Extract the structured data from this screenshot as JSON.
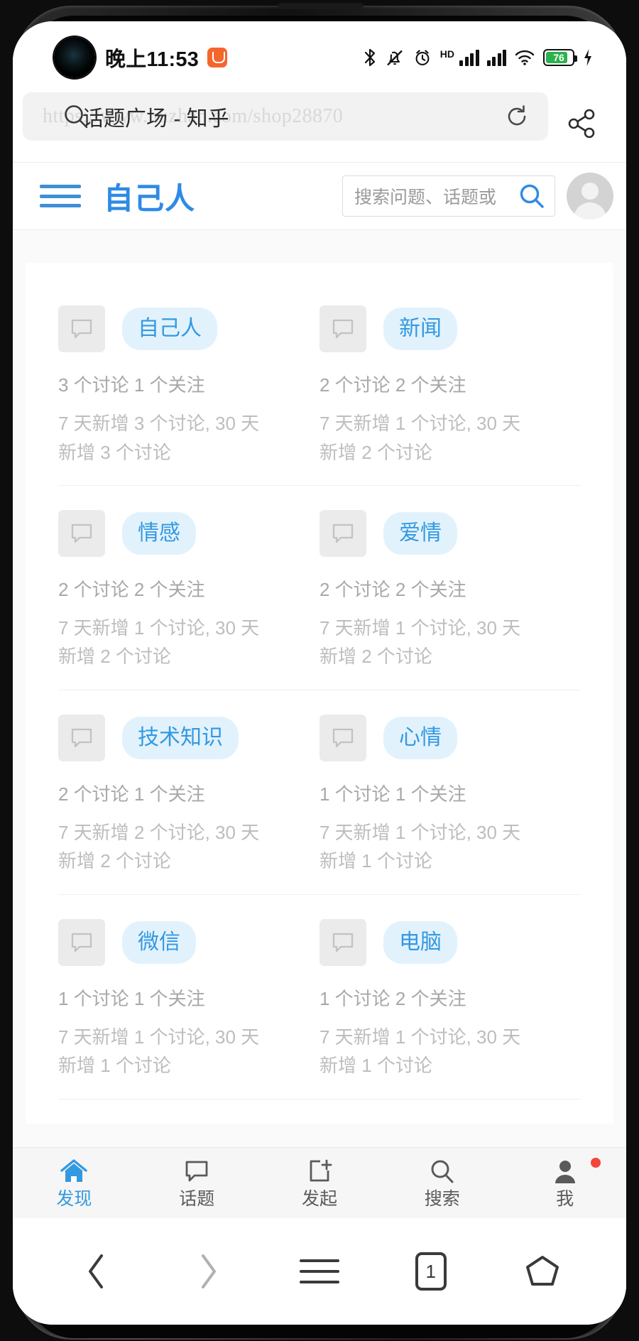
{
  "status_bar": {
    "time": "晚上11:53",
    "app_badge_icon": "orange-app-badge-icon",
    "icons": [
      "bluetooth-icon",
      "mute-bell-icon",
      "alarm-icon",
      "hd-icon",
      "signal-sim1-icon",
      "signal-sim2-icon",
      "wifi-icon",
      "battery-icon",
      "charging-icon"
    ],
    "hd_label": "HD",
    "battery_percent": "76"
  },
  "browser": {
    "url_watermark": "https://www.huzhan.com/shop28870",
    "page_title": "话题广场 - 知乎",
    "search_icon": "search-icon",
    "reload_icon": "reload-icon",
    "share_icon": "share-icon"
  },
  "site_header": {
    "menu_icon": "hamburger-menu-icon",
    "logo": "自己人",
    "search_placeholder": "搜索问题、话题或",
    "search_icon": "search-icon",
    "avatar_icon": "user-avatar-icon"
  },
  "topics": [
    [
      {
        "thumb_icon": "speech-bubble-icon",
        "name": "自己人",
        "stats": "3 个讨论 1 个关注",
        "growth": "7 天新增 3 个讨论, 30 天新增 3 个讨论"
      },
      {
        "thumb_icon": "speech-bubble-icon",
        "name": "新闻",
        "stats": "2 个讨论 2 个关注",
        "growth": "7 天新增 1 个讨论, 30 天新增 2 个讨论"
      }
    ],
    [
      {
        "thumb_icon": "speech-bubble-icon",
        "name": "情感",
        "stats": "2 个讨论 2 个关注",
        "growth": "7 天新增 1 个讨论, 30 天新增 2 个讨论"
      },
      {
        "thumb_icon": "speech-bubble-icon",
        "name": "爱情",
        "stats": "2 个讨论 2 个关注",
        "growth": "7 天新增 1 个讨论, 30 天新增 2 个讨论"
      }
    ],
    [
      {
        "thumb_icon": "speech-bubble-icon",
        "name": "技术知识",
        "stats": "2 个讨论 1 个关注",
        "growth": "7 天新增 2 个讨论, 30 天新增 2 个讨论"
      },
      {
        "thumb_icon": "speech-bubble-icon",
        "name": "心情",
        "stats": "1 个讨论 1 个关注",
        "growth": "7 天新增 1 个讨论, 30 天新增 1 个讨论"
      }
    ],
    [
      {
        "thumb_icon": "speech-bubble-icon",
        "name": "微信",
        "stats": "1 个讨论 1 个关注",
        "growth": "7 天新增 1 个讨论, 30 天新增 1 个讨论"
      },
      {
        "thumb_icon": "speech-bubble-icon",
        "name": "电脑",
        "stats": "1 个讨论 2 个关注",
        "growth": "7 天新增 1 个讨论, 30 天新增 1 个讨论"
      }
    ]
  ],
  "tab_bar": {
    "items": [
      {
        "label": "发现",
        "icon": "home-icon",
        "active": true
      },
      {
        "label": "话题",
        "icon": "speech-bubble-icon",
        "active": false
      },
      {
        "label": "发起",
        "icon": "compose-plus-icon",
        "active": false
      },
      {
        "label": "搜索",
        "icon": "search-icon",
        "active": false
      },
      {
        "label": "我",
        "icon": "person-icon",
        "active": false,
        "badge": true
      }
    ]
  },
  "system_nav": {
    "back_icon": "chevron-left-icon",
    "forward_icon": "chevron-right-icon",
    "menu_icon": "hamburger-menu-icon",
    "tab_count": "1",
    "home_icon": "home-pentagon-icon"
  },
  "colors": {
    "accent": "#3399e0",
    "pill_bg": "#e2f2fd",
    "badge_red": "#f4453c",
    "battery_green": "#2bb24c",
    "app_badge_orange": "#f4662c"
  }
}
